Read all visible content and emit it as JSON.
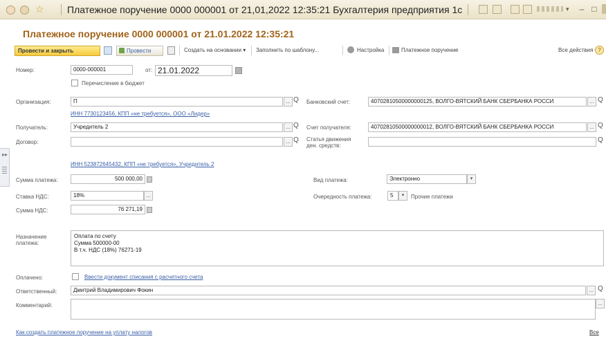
{
  "window": {
    "title": "Платежное поручение 0000 000001 от 21,01,2022 12:35:21 Бухгалтерия предприятия 1с",
    "minimize": "–",
    "maximize": "□"
  },
  "document": {
    "title": "Платежное поручение 0000 000001 от 21.01.2022 12:35:21"
  },
  "toolbar": {
    "post_close": "Провести и закрыть",
    "post": "Провести",
    "create_based": "Создать на основании ▾",
    "fill_template": "Заполнить по шаблону...",
    "settings": "Настройка",
    "payment_order": "Платежное поручение",
    "all_actions": "Все действия ▾",
    "help": "?"
  },
  "form": {
    "number_label": "Номер:",
    "number_value": "0000-000001",
    "date_label": "от:",
    "date_value": "21.01.2022",
    "budget_label": "Перечисление в бюджет",
    "org_label": "Организация:",
    "org_value": "П",
    "org_inn": "ИНН 7730123456, КПП «не требуется», ООО «Лидер»",
    "bank_label": "Банковский счет:",
    "bank_value": "40702810500000000125, ВОЛГО-ВЯТСКИЙ БАНК СБЕРБАНКА РОССИ",
    "recipient_label": "Получатель:",
    "recipient_value": "Учредитель 2",
    "recipient_account_label": "Счет получателя:",
    "recipient_account_value": "40702810500000000012, ВОЛГО-ВЯТСКИЙ БАНК СБЕРБАНКА РОССИ",
    "contract_label": "Договор:",
    "cashflow_label_1": "Статья движения",
    "cashflow_label_2": "ден. средств:",
    "recipient_inn": "ИНН 523872645432, КПП «не требуется», Учредитель 2",
    "sum_label": "Сумма платежа:",
    "sum_value": "500 000,00",
    "payment_type_label": "Вид платежа:",
    "payment_type_value": "Электронно",
    "vat_rate_label": "Ставка НДС:",
    "vat_rate_value": "18%",
    "priority_label": "Очередность платежа:",
    "priority_value": "5",
    "priority_text": "Прочие платежи",
    "vat_sum_label": "Сумма НДС:",
    "vat_sum_value": "76 271,19",
    "purpose_label_1": "Назначение",
    "purpose_label_2": "платежа:",
    "purpose_lines": [
      "Оплата по счету",
      "Сумма 500000-00",
      "В т.ч. НДС (18%) 76271-19"
    ],
    "paid_label": "Оплачено:",
    "paid_link": "Ввести документ списания с расчетного счета",
    "responsible_label": "Ответственный:",
    "responsible_value": "Дмитрий Владимирович Фокин",
    "comment_label": "Комментарий:",
    "footer_link": "Как создать платежное поручение на уплату налогов",
    "footer_right": "Все"
  }
}
